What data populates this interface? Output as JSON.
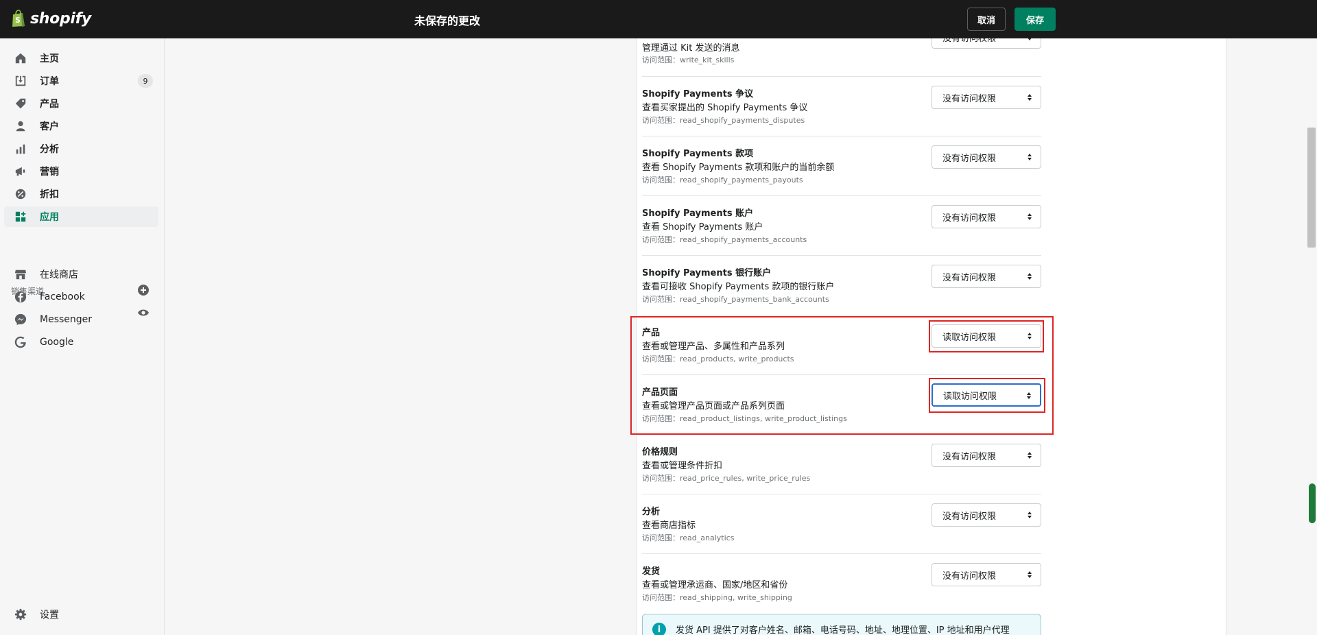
{
  "topbar": {
    "brand": "shopify",
    "unsaved_title": "未保存的更改",
    "cancel_label": "取消",
    "save_label": "保存"
  },
  "sidebar": {
    "items": [
      {
        "label": "主页",
        "icon": "home-icon"
      },
      {
        "label": "订单",
        "icon": "orders-icon",
        "badge": "9"
      },
      {
        "label": "产品",
        "icon": "tag-icon"
      },
      {
        "label": "客户",
        "icon": "customer-icon"
      },
      {
        "label": "分析",
        "icon": "analytics-icon"
      },
      {
        "label": "营销",
        "icon": "megaphone-icon"
      },
      {
        "label": "折扣",
        "icon": "discount-icon"
      },
      {
        "label": "应用",
        "icon": "apps-icon",
        "active": true
      }
    ],
    "sales_channels_label": "销售渠道",
    "channels": [
      {
        "label": "在线商店",
        "icon": "store-icon"
      },
      {
        "label": "Facebook",
        "icon": "facebook-icon"
      },
      {
        "label": "Messenger",
        "icon": "messenger-icon"
      },
      {
        "label": "Google",
        "icon": "google-icon"
      }
    ],
    "settings_label": "设置"
  },
  "permissions": [
    {
      "title": "",
      "desc": "管理通过 Kit 发送的消息",
      "scope": "访问范围：write_kit_skills",
      "value": "没有访问权限"
    },
    {
      "title": "Shopify Payments 争议",
      "desc": "查看买家提出的 Shopify Payments 争议",
      "scope": "访问范围：read_shopify_payments_disputes",
      "value": "没有访问权限"
    },
    {
      "title": "Shopify Payments 款项",
      "desc": "查看 Shopify Payments 款项和账户的当前余额",
      "scope": "访问范围：read_shopify_payments_payouts",
      "value": "没有访问权限"
    },
    {
      "title": "Shopify Payments 账户",
      "desc": "查看 Shopify Payments 账户",
      "scope": "访问范围：read_shopify_payments_accounts",
      "value": "没有访问权限"
    },
    {
      "title": "Shopify Payments 银行账户",
      "desc": "查看可接收 Shopify Payments 款项的银行账户",
      "scope": "访问范围：read_shopify_payments_bank_accounts",
      "value": "没有访问权限"
    },
    {
      "title": "产品",
      "desc": "查看或管理产品、多属性和产品系列",
      "scope": "访问范围：read_products, write_products",
      "value": "读取访问权限"
    },
    {
      "title": "产品页面",
      "desc": "查看或管理产品页面或产品系列页面",
      "scope": "访问范围：read_product_listings, write_product_listings",
      "value": "读取访问权限"
    },
    {
      "title": "价格规则",
      "desc": "查看或管理条件折扣",
      "scope": "访问范围：read_price_rules, write_price_rules",
      "value": "没有访问权限"
    },
    {
      "title": "分析",
      "desc": "查看商店指标",
      "scope": "访问范围：read_analytics",
      "value": "没有访问权限"
    },
    {
      "title": "发货",
      "desc": "查看或管理承运商、国家/地区和省份",
      "scope": "访问范围：read_shipping, write_shipping",
      "value": "没有访问权限"
    }
  ],
  "info_banner": {
    "text": "发货 API 提供了对客户姓名、邮箱、电话号码、地址、地理位置、IP 地址和用户代理"
  },
  "colors": {
    "accent": "#008060",
    "highlight": "#e02424",
    "topbar": "#1a1a1a"
  }
}
